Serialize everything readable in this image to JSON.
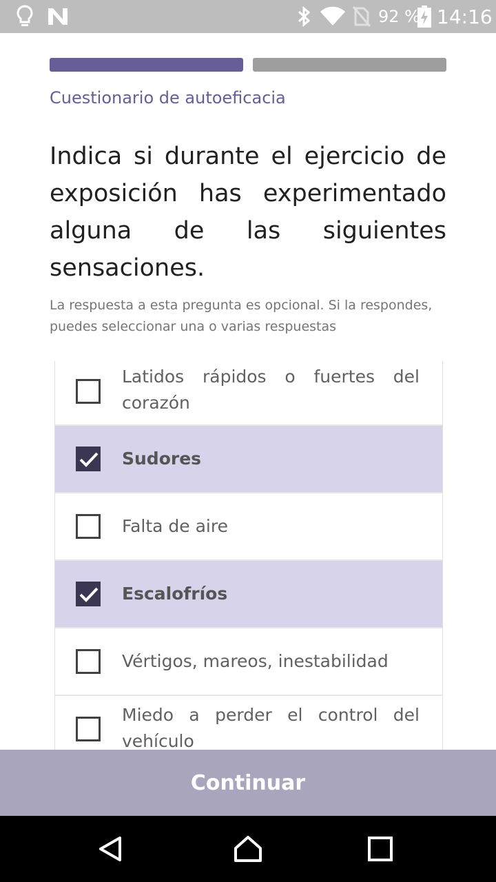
{
  "status_bar": {
    "battery_percent": "92 %",
    "time": "14:16",
    "icons": [
      "lightbulb-icon",
      "n-icon",
      "bluetooth-icon",
      "wifi-icon",
      "no-sim-icon",
      "battery-charging-icon"
    ]
  },
  "progress": {
    "step": 1,
    "total": 2
  },
  "header": {
    "subtitle": "Cuestionario de autoeficacia",
    "question": "Indica si durante el ejercicio de exposición has experimentado alguna de las siguientes sensaciones.",
    "hint": "La respuesta a esta pregunta es opcional. Si la respondes, puedes seleccionar una o varias respuestas"
  },
  "options": [
    {
      "label": "Latidos rápidos o fuertes del corazón",
      "checked": false
    },
    {
      "label": "Sudores",
      "checked": true
    },
    {
      "label": "Falta de aire",
      "checked": false
    },
    {
      "label": "Escalofríos",
      "checked": true
    },
    {
      "label": "Vértigos, mareos, inestabilidad",
      "checked": false
    },
    {
      "label": "Miedo a perder el control del vehículo",
      "checked": false
    }
  ],
  "actions": {
    "continue_label": "Continuar"
  },
  "colors": {
    "accent": "#675d99",
    "selected_bg": "#d7d3ea",
    "button_bg": "#a9a5bd"
  }
}
